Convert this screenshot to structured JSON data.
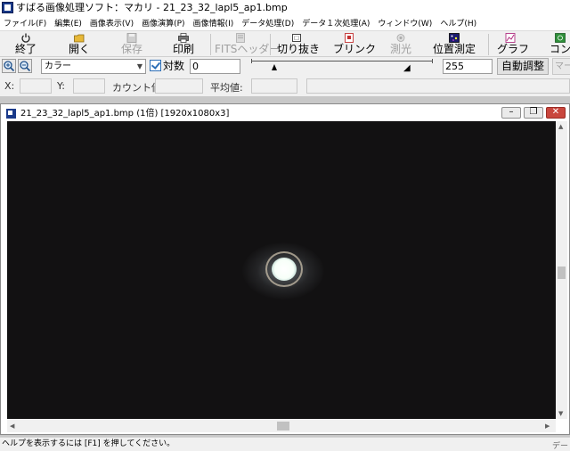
{
  "app": {
    "title": "すばる画像処理ソフト：マカリ - 21_23_32_lapl5_ap1.bmp"
  },
  "menu": [
    "ファイル(F)",
    "編集(E)",
    "画像表示(V)",
    "画像演算(P)",
    "画像情報(I)",
    "データ処理(D)",
    "データ１次処理(A)",
    "ウィンドウ(W)",
    "ヘルプ(H)"
  ],
  "toolbar": {
    "exit": "終了",
    "open": "開く",
    "save": "保存",
    "print": "印刷",
    "fits_header": "FITSヘッダー",
    "crop": "切り抜き",
    "blink": "ブリンク",
    "photometry": "測光",
    "astrometry": "位置測定",
    "graph": "グラフ",
    "contour": "コント"
  },
  "display": {
    "color_mode": "カラー",
    "log_label": "対数",
    "log_checked": true,
    "min_value": "0",
    "max_value": "255",
    "auto_adjust": "自動調整",
    "extra_button": "マー"
  },
  "readouts": {
    "x_label": "X:",
    "y_label": "Y:",
    "count_label": "カウント値:",
    "mean_label": "平均値:"
  },
  "child_window": {
    "title": "21_23_32_lapl5_ap1.bmp (1倍) [1920x1080x3]"
  },
  "status": {
    "help_text": "ヘルプを表示するには [F1] を押してください。",
    "right_text": "デー"
  },
  "colors": {
    "image_background": "#121112",
    "close_button": "#c9463d"
  }
}
